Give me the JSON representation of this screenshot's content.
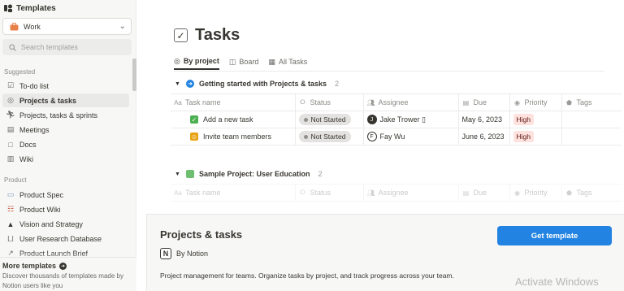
{
  "sidebar": {
    "header": "Templates",
    "category_select": {
      "value": "Work"
    },
    "search": {
      "placeholder": "Search templates"
    },
    "suggested_label": "Suggested",
    "suggested": [
      {
        "label": "To-do list",
        "icon": "checkbox-icon"
      },
      {
        "label": "Projects & tasks",
        "icon": "target-icon",
        "active": true
      },
      {
        "label": "Projects, tasks & sprints",
        "icon": "runner-icon"
      },
      {
        "label": "Meetings",
        "icon": "calendar-icon"
      },
      {
        "label": "Docs",
        "icon": "doc-icon"
      },
      {
        "label": "Wiki",
        "icon": "book-icon"
      }
    ],
    "product_label": "Product",
    "product": [
      {
        "label": "Product Spec",
        "icon": "spec-icon"
      },
      {
        "label": "Product Wiki",
        "icon": "wiki-icon"
      },
      {
        "label": "Vision and Strategy",
        "icon": "mountain-icon"
      },
      {
        "label": "User Research Database",
        "icon": "research-icon"
      },
      {
        "label": "Product Launch Brief",
        "icon": "launch-icon"
      }
    ],
    "more": {
      "title": "More templates",
      "description": "Discover thousands of templates made by Notion users like you"
    }
  },
  "page": {
    "title": "Tasks",
    "views": [
      {
        "label": "By project",
        "active": true
      },
      {
        "label": "Board"
      },
      {
        "label": "All Tasks"
      }
    ],
    "columns": [
      "Task name",
      "Status",
      "Assignee",
      "Due",
      "Priority",
      "Tags"
    ],
    "groups": [
      {
        "name": "Getting started with Projects & tasks",
        "count": "2",
        "rows": [
          {
            "name": "Add a new task",
            "status": "Not Started",
            "assignee": "Jake Trower ▯",
            "due": "May 6, 2023",
            "priority": "High"
          },
          {
            "name": "Invite team members",
            "status": "Not Started",
            "assignee": "Fay Wu",
            "due": "June 6, 2023",
            "priority": "High"
          }
        ]
      },
      {
        "name": "Sample Project: User Education",
        "count": "2",
        "rows": []
      }
    ]
  },
  "panel": {
    "title": "Projects & tasks",
    "author": "By Notion",
    "description": "Project management for teams. Organize tasks by project, and track progress across your team.",
    "button": "Get template"
  },
  "watermark": "Activate Windows",
  "colors": {
    "accent": "#2383e2",
    "priority_bg": "#ffe2dd",
    "status_bg": "#e3e2e0"
  }
}
